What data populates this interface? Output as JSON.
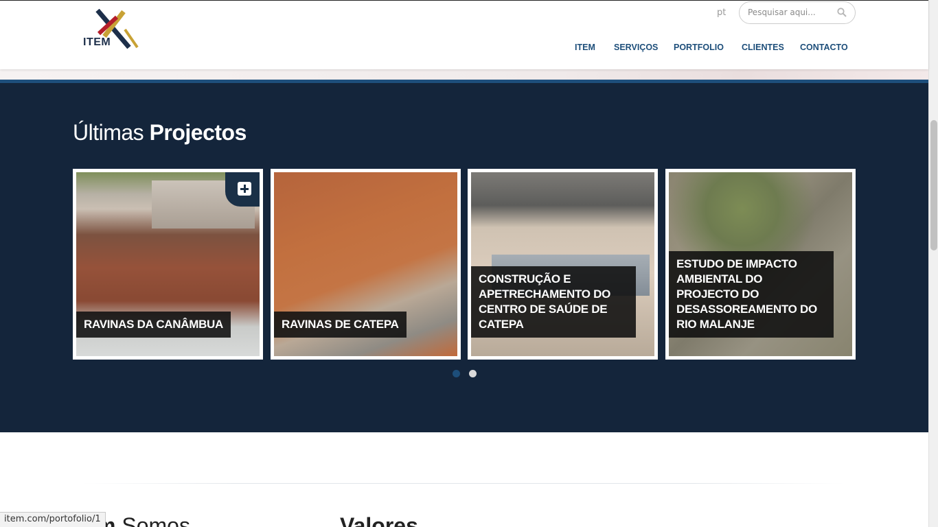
{
  "header": {
    "logo_text": "ITEM",
    "lang": "pt",
    "search_placeholder": "Pesquisar aqui...",
    "nav": [
      "ITEM",
      "SERVIÇOS",
      "PORTFOLIO",
      "CLIENTES",
      "CONTACTO"
    ]
  },
  "projects": {
    "title_light": "Últimas",
    "title_bold": "Projectos",
    "cards": [
      {
        "label": "RAVINAS DA CANÂMBUA"
      },
      {
        "label": "RAVINAS DE CATEPA"
      },
      {
        "label": "CONSTRUÇÃO E APETRECHAMENTO DO CENTRO DE SAÚDE DE CATEPA"
      },
      {
        "label": "ESTUDO DE IMPACTO AMBIENTAL DO PROJECTO DO DESASSOREAMENTO DO RIO MALANJE"
      }
    ],
    "active_slide": 1,
    "slide_count": 2
  },
  "lower": {
    "heading1_bold": "m",
    "heading1_light": " Somos",
    "heading2": "Valores"
  },
  "statusbar": {
    "url": "item.com/portofolio/1"
  },
  "colors": {
    "brand_blue": "#1d4e7a",
    "section_bg": "#14253b",
    "logo_red": "#b41e2a",
    "logo_gold": "#c8a235"
  }
}
